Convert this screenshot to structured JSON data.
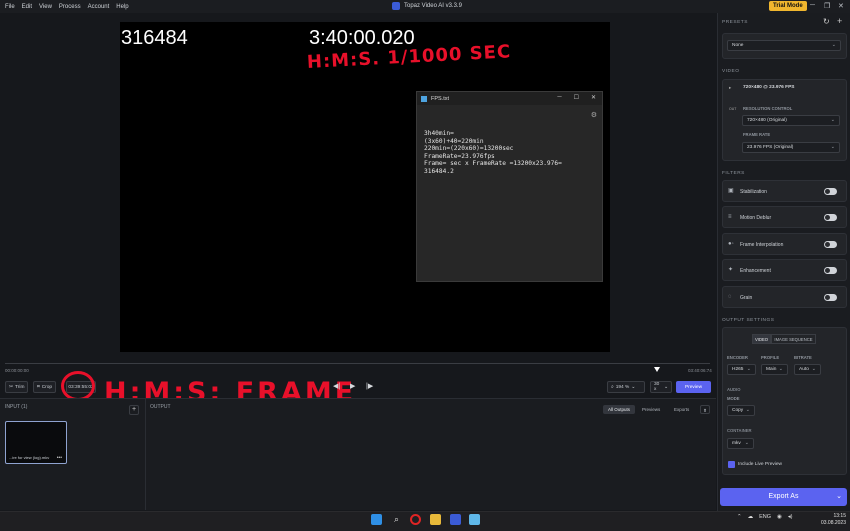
{
  "menubar": {
    "items": [
      "File",
      "Edit",
      "View",
      "Process",
      "Account",
      "Help"
    ],
    "app_title": "Topaz Video AI  v3.3.9",
    "trial_label": "Trial Mode"
  },
  "video_overlay": {
    "frame_number": "316484",
    "timecode": "3:40:00.020",
    "annotation_top": "H:M:S. 1/1000 SEC",
    "annotation_bottom": "H:M:S; FRAME"
  },
  "notepad": {
    "title": "FPS.txt",
    "lines": [
      "3h40min=",
      "(3x60)+40=220min",
      "220min=(220x60)=13200sec",
      "FrameRate=23.976fps",
      "Frame= sec x FrameRate =13200x23.976=",
      "316484.2"
    ]
  },
  "timeline": {
    "start_time": "00:00:00:00",
    "end_time": "03:40:06:74",
    "trim_label": "Trim",
    "crop_label": "Crop",
    "timecode_value": "03:39:55:02",
    "zoom_value": "194 %",
    "fps_value": "30 x",
    "preview_label": "Preview"
  },
  "input_panel": {
    "header": "INPUT (1)",
    "thumb_label": "...ire for view (log).mkv"
  },
  "output_panel": {
    "header": "OUTPUT",
    "tabs": [
      "All Outputs",
      "Previews",
      "Exports"
    ]
  },
  "right_panel": {
    "presets_header": "PRESETS",
    "preset_value": "None",
    "video_header": "VIDEO",
    "video_info": "720×480 @ 23.976 FPS",
    "resolution_label": "RESOLUTION CONTROL",
    "resolution_value": "720×480 (Original)",
    "framerate_label": "FRAME RATE",
    "framerate_value": "23.976 FPS (Original)",
    "filters_header": "FILTERS",
    "filters": [
      {
        "name": "Stabilization",
        "icon": "stabilization-icon",
        "glyph": "▣"
      },
      {
        "name": "Motion Deblur",
        "icon": "motion-deblur-icon",
        "glyph": "≡"
      },
      {
        "name": "Frame Interpolation",
        "icon": "frame-interpolation-icon",
        "glyph": "●◦"
      },
      {
        "name": "Enhancement",
        "icon": "enhancement-icon",
        "glyph": "✦"
      },
      {
        "name": "Grain",
        "icon": "grain-icon",
        "glyph": "◌"
      }
    ],
    "output_header": "OUTPUT SETTINGS",
    "seg_video": "VIDEO",
    "seg_image": "IMAGE SEQUENCE",
    "encoder_label": "ENCODER",
    "encoder_value": "H265",
    "profile_label": "PROFILE",
    "profile_value": "Main",
    "bitrate_label": "BITRATE",
    "bitrate_value": "Auto",
    "audio_label": "AUDIO",
    "mode_label": "MODE",
    "mode_value": "Copy",
    "container_label": "CONTAINER",
    "container_value": "mkv",
    "live_preview_label": "Include Live Preview",
    "export_label": "Export As"
  },
  "taskbar": {
    "lang": "ENG",
    "time": "13:15",
    "date": "03.08.2023"
  },
  "colors": {
    "accent": "#5b63f0",
    "trial": "#f0b62e",
    "annotation": "#e8102a"
  }
}
